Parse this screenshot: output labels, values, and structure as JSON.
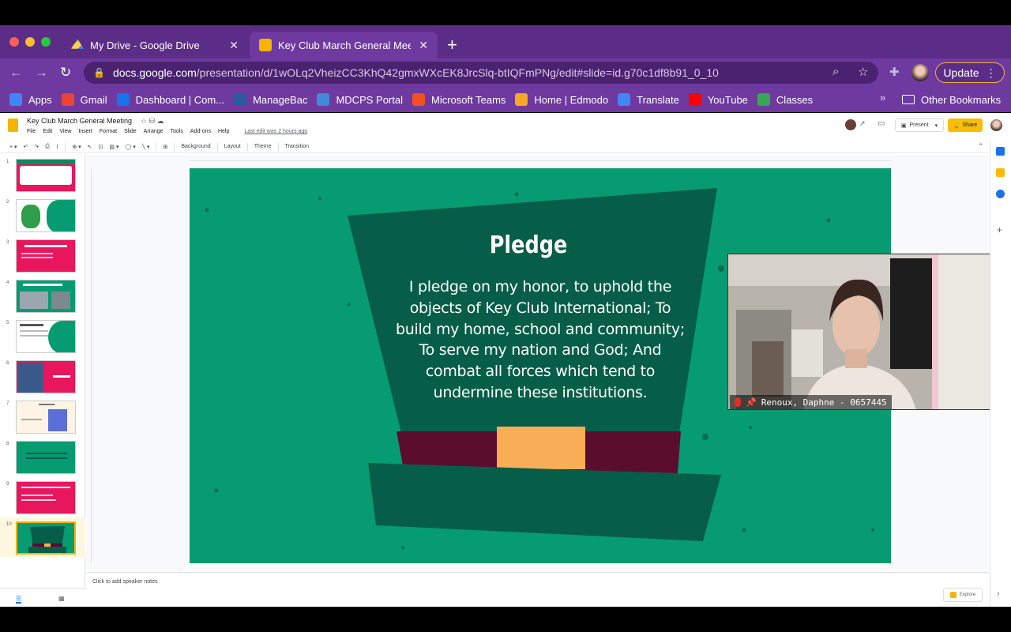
{
  "browser": {
    "tabs": [
      {
        "title": "My Drive - Google Drive",
        "active": false
      },
      {
        "title": "Key Club March General Meeti",
        "active": true
      }
    ],
    "url_host": "docs.google.com",
    "url_path": "/presentation/d/1wOLq2VheizCC3KhQ42gmxWXcEK8JrcSlq-btIQFmPNg/edit#slide=id.g70c1df8b91_0_10",
    "update_label": "Update",
    "bookmarks": [
      {
        "label": "Apps",
        "color": "#4285f4"
      },
      {
        "label": "Gmail",
        "color": "#ea4335"
      },
      {
        "label": "Dashboard | Com...",
        "color": "#1a73e8"
      },
      {
        "label": "ManageBac",
        "color": "#2c5aa0"
      },
      {
        "label": "MDCPS Portal",
        "color": "#3f8bd6"
      },
      {
        "label": "Microsoft Teams",
        "color": "#f25022"
      },
      {
        "label": "Home | Edmodo",
        "color": "#f7a823"
      },
      {
        "label": "Translate",
        "color": "#4285f4"
      },
      {
        "label": "YouTube",
        "color": "#ff0000"
      },
      {
        "label": "Classes",
        "color": "#34a853"
      }
    ],
    "bookmarks_more": "»",
    "other_bookmarks": "Other Bookmarks"
  },
  "slides": {
    "doc_title": "Key Club March General Meeting",
    "menus": [
      "File",
      "Edit",
      "View",
      "Insert",
      "Format",
      "Slide",
      "Arrange",
      "Tools",
      "Add-ons",
      "Help"
    ],
    "last_edit": "Last edit was 2 hours ago",
    "present_label": "Present",
    "share_label": "Share",
    "toolbar": {
      "background": "Background",
      "layout": "Layout",
      "theme": "Theme",
      "transition": "Transition"
    },
    "slide_numbers": [
      "1",
      "2",
      "3",
      "4",
      "5",
      "6",
      "7",
      "8",
      "9",
      "10"
    ],
    "selected_slide": "10",
    "speaker_notes": "Click to add speaker notes",
    "explore_label": "Explore"
  },
  "slide_content": {
    "title": "Pledge",
    "body": "I pledge on my honor, to uphold the objects of Key Club International; To build my home, school and community; To serve my nation and God; And combat all forces which tend to undermine these institutions.",
    "colors": {
      "background": "#079b72",
      "hat_dark": "#075e48",
      "hat_band": "#5a0d2c",
      "buckle": "#f9ad57"
    }
  },
  "video": {
    "participant": "Renoux, Daphne - 0657445"
  }
}
